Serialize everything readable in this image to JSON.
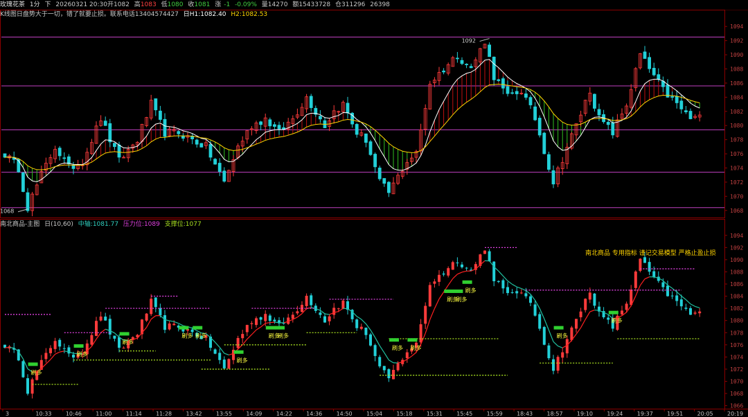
{
  "topbar": {
    "symbol": "玫瑰花茶",
    "period": "1分",
    "dir": "下",
    "datetime": "20260321 20:30",
    "open_label": "开",
    "open": "1082",
    "high_label": "高",
    "high": "1083",
    "low_label": "低",
    "low": "1080",
    "close_label": "收",
    "close": "1081",
    "change_label": "涨",
    "change": "-1",
    "change_pct": "-0.09%",
    "volume_label": "量",
    "volume": "14270",
    "amount_label": "额",
    "amount": "15433728",
    "oi_label": "仓",
    "oi": "311296",
    "oi_extra": "26398"
  },
  "panel1": {
    "title": "K线图",
    "note": "日盘势大于一切，错了就要止损。联系电话13404574427",
    "h1": "日H1:1082.40",
    "h2": "H2:1082.53"
  },
  "panel2": {
    "title": "南北商品-主图",
    "params": "日(10,60)",
    "mid": "中轴:1081.77",
    "resist": "压力位:1089",
    "support": "支撑位:1077",
    "banner": "南北商品 专用指标 谨记交易模型 严格止盈止损"
  },
  "chart_data": [
    {
      "type": "candlestick",
      "panel": "top",
      "ylim": [
        1067,
        1095
      ],
      "yticks": [
        1068,
        1070,
        1072,
        1074,
        1076,
        1078,
        1080,
        1082,
        1084,
        1086,
        1088,
        1090,
        1092,
        1094
      ],
      "annotations": [
        {
          "text": "1092",
          "x_index": 106,
          "y": 1092.3
        },
        {
          "text": "1068",
          "x_index": 5,
          "y": 1068.2
        }
      ],
      "hlines": [
        1092.5,
        1085.6,
        1079.4,
        1073.4,
        1068.4
      ],
      "keypoints": [
        [
          0,
          1076
        ],
        [
          3,
          1074
        ],
        [
          5,
          1068.5
        ],
        [
          8,
          1073
        ],
        [
          11,
          1077
        ],
        [
          14,
          1074
        ],
        [
          17,
          1075
        ],
        [
          21,
          1081
        ],
        [
          25,
          1075
        ],
        [
          29,
          1078
        ],
        [
          32,
          1083
        ],
        [
          35,
          1079
        ],
        [
          38,
          1079
        ],
        [
          41,
          1078
        ],
        [
          44,
          1077
        ],
        [
          48,
          1072
        ],
        [
          51,
          1077
        ],
        [
          54,
          1080
        ],
        [
          57,
          1081
        ],
        [
          60,
          1079
        ],
        [
          63,
          1081
        ],
        [
          66,
          1084
        ],
        [
          70,
          1080
        ],
        [
          72,
          1082
        ],
        [
          74,
          1083
        ],
        [
          77,
          1079
        ],
        [
          79,
          1078
        ],
        [
          82,
          1072
        ],
        [
          84,
          1070.5
        ],
        [
          88,
          1075
        ],
        [
          90,
          1076
        ],
        [
          93,
          1086
        ],
        [
          96,
          1088
        ],
        [
          99,
          1090
        ],
        [
          102,
          1088
        ],
        [
          105,
          1092
        ],
        [
          107,
          1087
        ],
        [
          110,
          1084
        ],
        [
          113,
          1085
        ],
        [
          116,
          1081
        ],
        [
          120,
          1072
        ],
        [
          123,
          1077
        ],
        [
          125,
          1080
        ],
        [
          128,
          1085
        ],
        [
          130,
          1081
        ],
        [
          133,
          1079
        ],
        [
          136,
          1083
        ],
        [
          139,
          1090
        ],
        [
          141,
          1088
        ],
        [
          144,
          1085
        ],
        [
          147,
          1083
        ],
        [
          150,
          1081
        ]
      ]
    },
    {
      "type": "candlestick",
      "panel": "bottom",
      "ylim": [
        1065.5,
        1095
      ],
      "yticks": [
        1066,
        1068,
        1070,
        1072,
        1074,
        1076,
        1078,
        1080,
        1082,
        1084,
        1086,
        1088,
        1090,
        1092,
        1094
      ],
      "xticks": [
        "3",
        "10:33",
        "10:46",
        "11:00",
        "11:14",
        "11:28",
        "13:42",
        "13:55",
        "14:09",
        "14:22",
        "14:36",
        "14:50",
        "15:04",
        "15:18",
        "15:31",
        "15:45",
        "15:59",
        "18:43",
        "18:57",
        "19:10",
        "19:24",
        "19:37",
        "19:51",
        "20:05",
        "20:19"
      ],
      "signal_label": "刷多",
      "signals": [
        [
          6,
          1071.5
        ],
        [
          16,
          1074.5
        ],
        [
          26,
          1076.5
        ],
        [
          39,
          1077.5
        ],
        [
          42,
          1077.5
        ],
        [
          51,
          1073.5
        ],
        [
          58,
          1077.5
        ],
        [
          60,
          1077.5
        ],
        [
          85,
          1075.5
        ],
        [
          89,
          1075.5
        ],
        [
          97,
          1083.5
        ],
        [
          99,
          1083.5
        ],
        [
          101,
          1085
        ],
        [
          121,
          1077.5
        ],
        [
          133,
          1080
        ]
      ],
      "resist_segments": [
        [
          0,
          10,
          1081
        ],
        [
          13,
          23,
          1078
        ],
        [
          32,
          38,
          1084
        ],
        [
          22,
          45,
          1082
        ],
        [
          54,
          68,
          1082
        ],
        [
          71,
          85,
          1083.5
        ],
        [
          105,
          112,
          1092
        ],
        [
          114,
          148,
          1085
        ],
        [
          139,
          151,
          1088.5
        ]
      ],
      "support_segments": [
        [
          6,
          16,
          1069.5
        ],
        [
          15,
          45,
          1073.5
        ],
        [
          25,
          33,
          1075
        ],
        [
          43,
          58,
          1072
        ],
        [
          48,
          66,
          1076
        ],
        [
          66,
          77,
          1078
        ],
        [
          84,
          108,
          1077
        ],
        [
          82,
          110,
          1071
        ],
        [
          117,
          133,
          1073
        ],
        [
          134,
          152,
          1077
        ]
      ]
    }
  ],
  "colors": {
    "up": "#ff3b3b",
    "down": "#22d0d8",
    "ma1": "#ffffff",
    "ma2": "#ffd400",
    "fill_up": "#c01010",
    "fill_down": "#30c020",
    "hline": "#c040c0",
    "resist": "#e040e0",
    "support": "#a8e020",
    "mid": "#ff2020",
    "signal": "#ffff40",
    "banner": "#ffd400"
  }
}
